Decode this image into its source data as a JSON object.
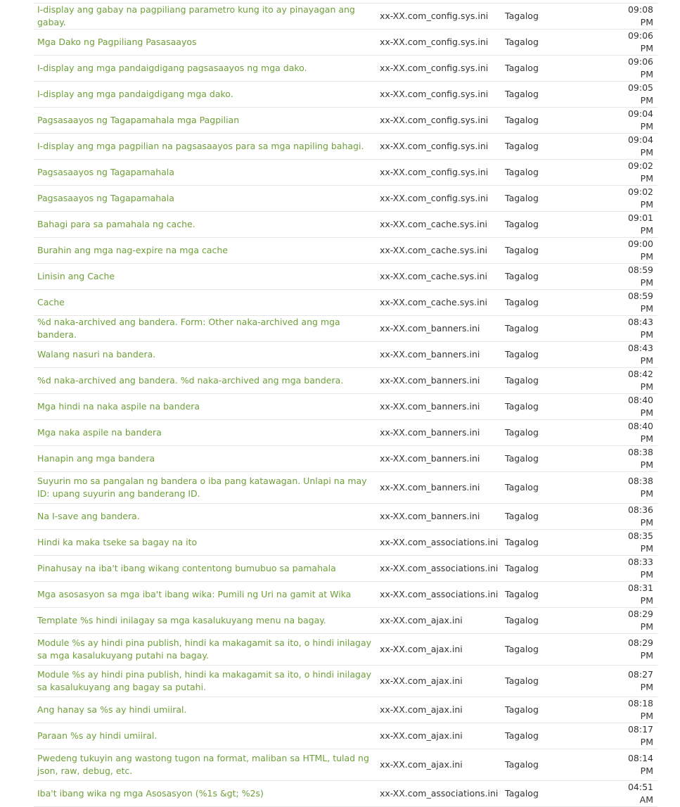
{
  "rows": [
    {
      "title": "I-display ang gabay na pagpiliang parametro kung ito ay pinayagan ang gabay.",
      "file": "xx-XX.com_config.sys.ini",
      "language": "Tagalog",
      "time": "09:08 PM",
      "lines": 1
    },
    {
      "title": "Mga Dako ng Pagpiliang Pasasaayos",
      "file": "xx-XX.com_config.sys.ini",
      "language": "Tagalog",
      "time": "09:06 PM",
      "lines": 1
    },
    {
      "title": "I-display ang mga pandaigdigang pagsasaayos ng mga dako.",
      "file": "xx-XX.com_config.sys.ini",
      "language": "Tagalog",
      "time": "09:06 PM",
      "lines": 1
    },
    {
      "title": "I-display ang mga pandaigdigang mga dako.",
      "file": "xx-XX.com_config.sys.ini",
      "language": "Tagalog",
      "time": "09:05 PM",
      "lines": 1
    },
    {
      "title": "Pagsasaayos ng Tagapamahala mga Pagpilian",
      "file": "xx-XX.com_config.sys.ini",
      "language": "Tagalog",
      "time": "09:04 PM",
      "lines": 1
    },
    {
      "title": "I-display ang mga pagpilian na pagsasaayos para sa mga napiling bahagi.",
      "file": "xx-XX.com_config.sys.ini",
      "language": "Tagalog",
      "time": "09:04 PM",
      "lines": 1
    },
    {
      "title": "Pagsasaayos ng Tagapamahala",
      "file": "xx-XX.com_config.sys.ini",
      "language": "Tagalog",
      "time": "09:02 PM",
      "lines": 1
    },
    {
      "title": "Pagsasaayos ng Tagapamahala",
      "file": "xx-XX.com_config.sys.ini",
      "language": "Tagalog",
      "time": "09:02 PM",
      "lines": 1
    },
    {
      "title": "Bahagi para sa pamahala ng cache.",
      "file": "xx-XX.com_cache.sys.ini",
      "language": "Tagalog",
      "time": "09:01 PM",
      "lines": 1
    },
    {
      "title": "Burahin ang mga nag-expire na mga cache",
      "file": "xx-XX.com_cache.sys.ini",
      "language": "Tagalog",
      "time": "09:00 PM",
      "lines": 1
    },
    {
      "title": "Linisin ang Cache",
      "file": "xx-XX.com_cache.sys.ini",
      "language": "Tagalog",
      "time": "08:59 PM",
      "lines": 1
    },
    {
      "title": "Cache",
      "file": "xx-XX.com_cache.sys.ini",
      "language": "Tagalog",
      "time": "08:59 PM",
      "lines": 1
    },
    {
      "title": "%d naka-archived ang bandera. Form: Other naka-archived ang mga bandera.",
      "file": "xx-XX.com_banners.ini",
      "language": "Tagalog",
      "time": "08:43 PM",
      "lines": 1
    },
    {
      "title": "Walang nasuri na bandera.",
      "file": "xx-XX.com_banners.ini",
      "language": "Tagalog",
      "time": "08:43 PM",
      "lines": 1
    },
    {
      "title": "%d naka-archived ang bandera. %d naka-archived ang mga bandera.",
      "file": "xx-XX.com_banners.ini",
      "language": "Tagalog",
      "time": "08:42 PM",
      "lines": 1
    },
    {
      "title": "Mga hindi na naka aspile na bandera",
      "file": "xx-XX.com_banners.ini",
      "language": "Tagalog",
      "time": "08:40 PM",
      "lines": 1
    },
    {
      "title": "Mga naka aspile na bandera",
      "file": "xx-XX.com_banners.ini",
      "language": "Tagalog",
      "time": "08:40 PM",
      "lines": 1
    },
    {
      "title": "Hanapin ang mga bandera",
      "file": "xx-XX.com_banners.ini",
      "language": "Tagalog",
      "time": "08:38 PM",
      "lines": 1
    },
    {
      "title": "Suyurin mo sa pangalan ng bandera o iba pang katawagan. Unlapi na may ID: upang suyurin ang banderang ID.",
      "file": "xx-XX.com_banners.ini",
      "language": "Tagalog",
      "time": "08:38 PM",
      "lines": 2
    },
    {
      "title": "Na I-save ang bandera.",
      "file": "xx-XX.com_banners.ini",
      "language": "Tagalog",
      "time": "08:36 PM",
      "lines": 1
    },
    {
      "title": "Hindi ka maka tseke sa bagay na ito",
      "file": "xx-XX.com_associations.ini",
      "language": "Tagalog",
      "time": "08:35 PM",
      "lines": 1
    },
    {
      "title": "Pinahusay na iba't ibang wikang contentong bumubuo sa pamahala",
      "file": "xx-XX.com_associations.ini",
      "language": "Tagalog",
      "time": "08:33 PM",
      "lines": 1
    },
    {
      "title": "Mga asosasyon sa mga iba't ibang wika: Pumili ng Uri na gamit at Wika",
      "file": "xx-XX.com_associations.ini",
      "language": "Tagalog",
      "time": "08:31 PM",
      "lines": 1
    },
    {
      "title": "Template %s hindi inilagay sa mga kasalukuyang menu na bagay.",
      "file": "xx-XX.com_ajax.ini",
      "language": "Tagalog",
      "time": "08:29 PM",
      "lines": 1
    },
    {
      "title": "Module %s ay hindi pina publish, hindi ka makagamit sa ito, o hindi inilagay sa mga kasalukuyang putahi na bagay.",
      "file": "xx-XX.com_ajax.ini",
      "language": "Tagalog",
      "time": "08:29 PM",
      "lines": 2
    },
    {
      "title": "Module %s ay hindi pina publish, hindi ka makagamit sa ito, o hindi inilagay sa kasalukuyang ang bagay sa putahi.",
      "file": "xx-XX.com_ajax.ini",
      "language": "Tagalog",
      "time": "08:27 PM",
      "lines": 2
    },
    {
      "title": "Ang hanay sa %s ay hindi umiiral.",
      "file": "xx-XX.com_ajax.ini",
      "language": "Tagalog",
      "time": "08:18 PM",
      "lines": 1
    },
    {
      "title": "Paraan %s ay hindi umiiral.",
      "file": "xx-XX.com_ajax.ini",
      "language": "Tagalog",
      "time": "08:17 PM",
      "lines": 1
    },
    {
      "title": "Pwedeng tukuyin ang wastong tugon na format, maliban sa HTML, tulad ng json, raw, debug, etc.",
      "file": "xx-XX.com_ajax.ini",
      "language": "Tagalog",
      "time": "08:14 PM",
      "lines": 2
    },
    {
      "title": "Iba't ibang wika ng mga Asosasyon (%1s &gt; %2s)",
      "file": "xx-XX.com_associations.ini",
      "language": "Tagalog",
      "time": "04:51 AM",
      "lines": 1
    }
  ]
}
